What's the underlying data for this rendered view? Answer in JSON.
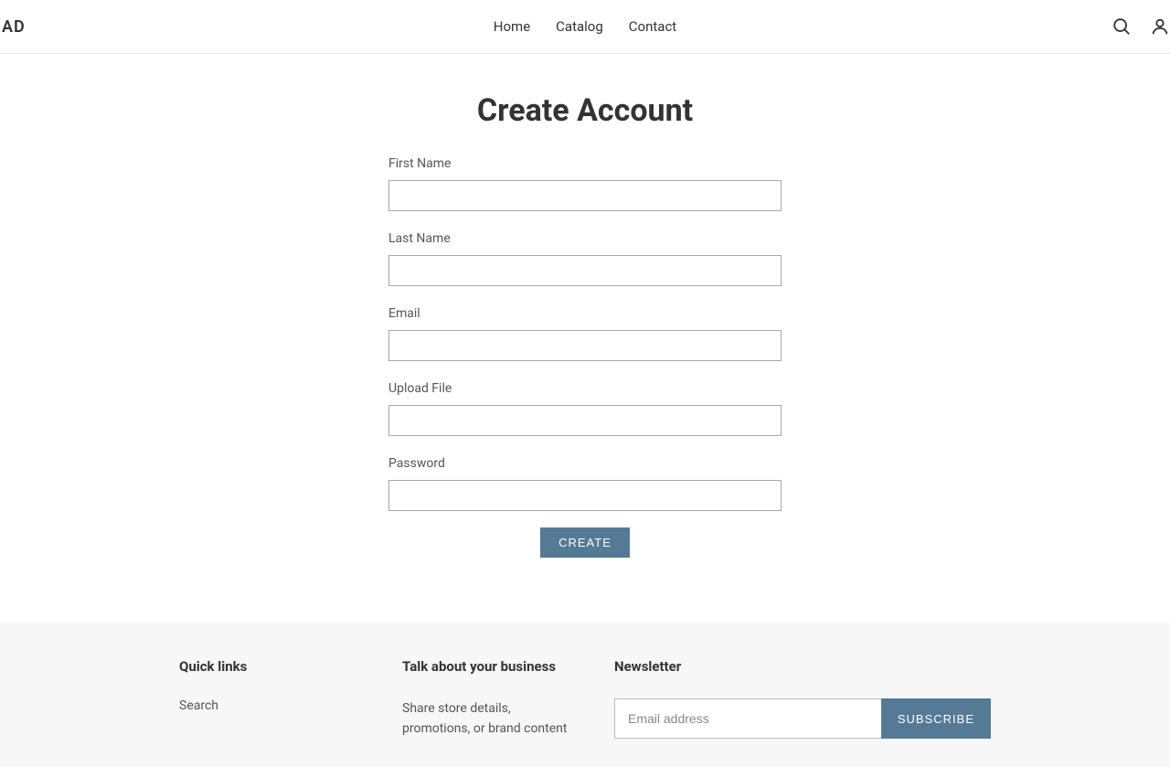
{
  "header": {
    "logo": "AD",
    "nav": {
      "home": "Home",
      "catalog": "Catalog",
      "contact": "Contact"
    }
  },
  "page": {
    "title": "Create Account"
  },
  "form": {
    "first_name_label": "First Name",
    "last_name_label": "Last Name",
    "email_label": "Email",
    "upload_label": "Upload File",
    "password_label": "Password",
    "create_button": "CREATE"
  },
  "footer": {
    "quick_links_heading": "Quick links",
    "search_link": "Search",
    "talk_heading": "Talk about your business",
    "talk_text": "Share store details, promotions, or brand content",
    "newsletter_heading": "Newsletter",
    "email_placeholder": "Email address",
    "subscribe_button": "SUBSCRIBE"
  }
}
